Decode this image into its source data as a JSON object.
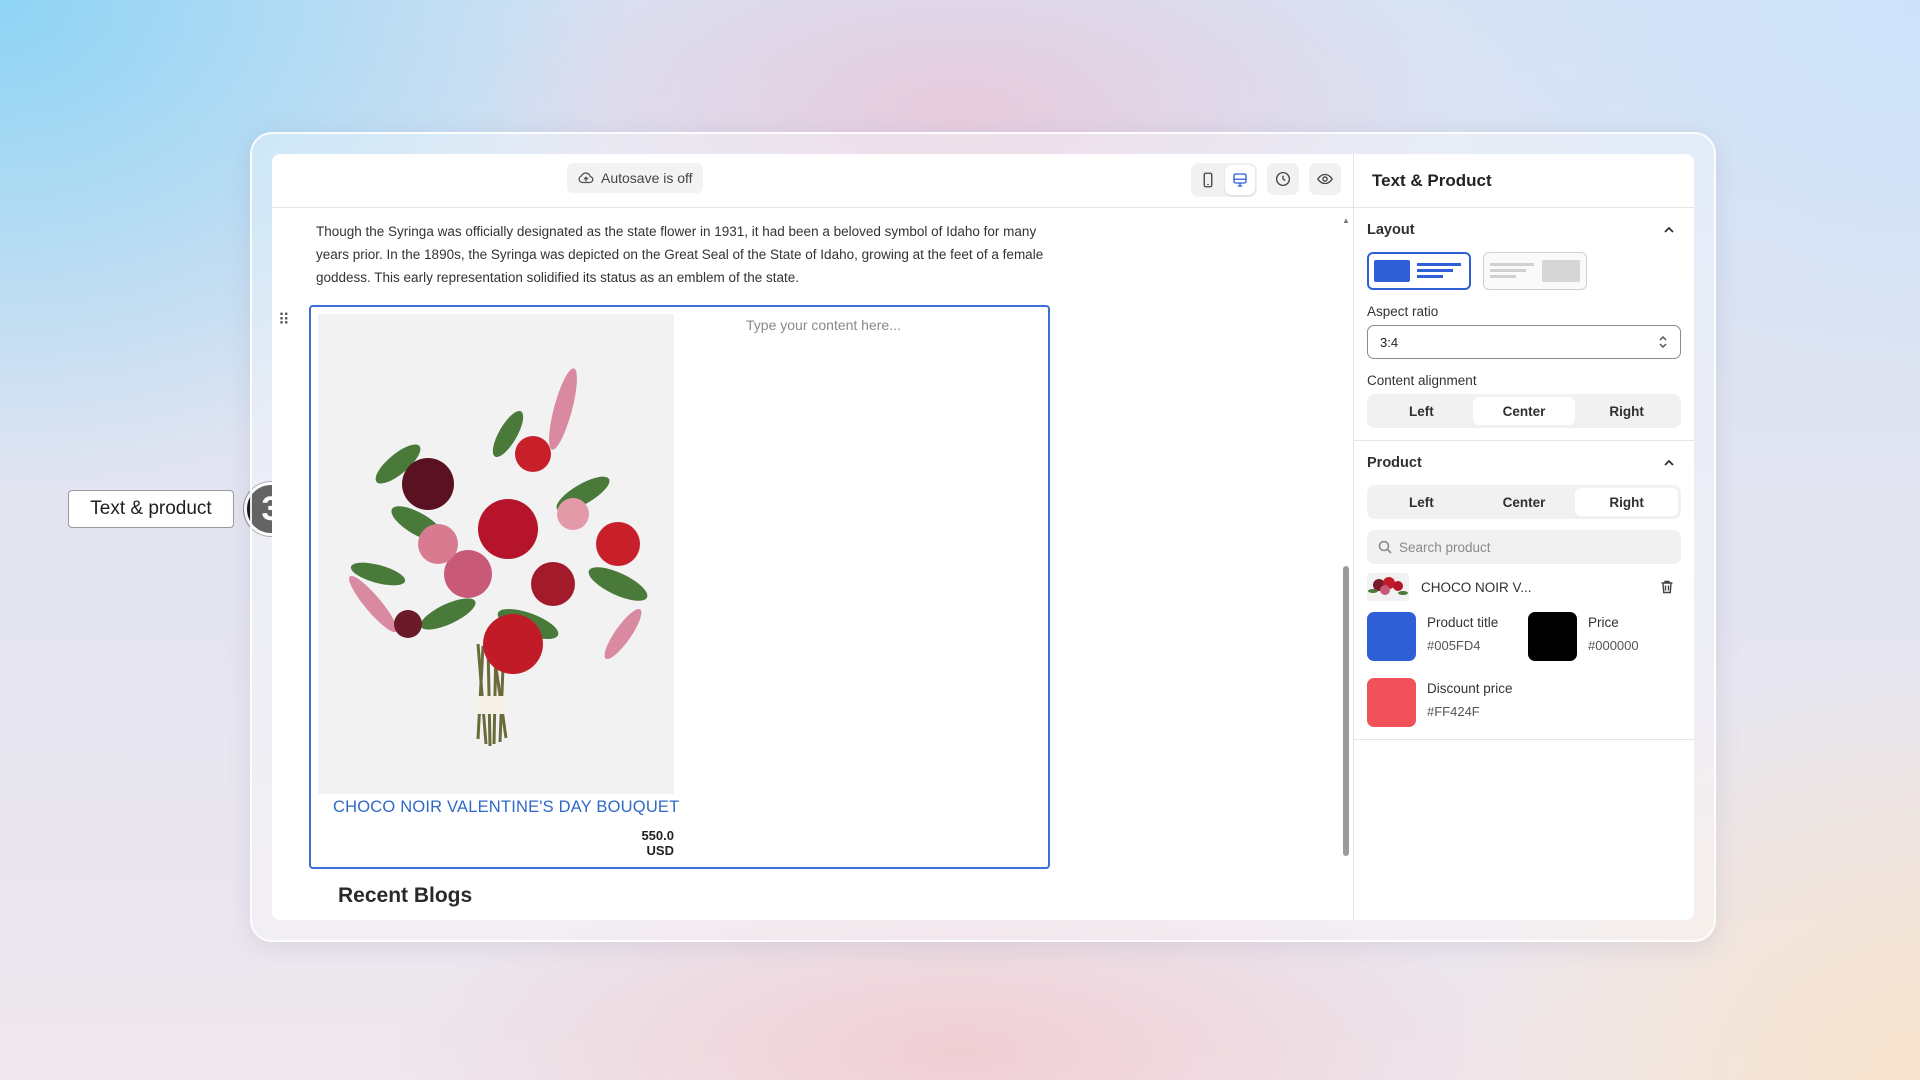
{
  "callout": {
    "label": "Text & product",
    "step": "3"
  },
  "toolbar": {
    "autosave_label": "Autosave is off"
  },
  "editor": {
    "paragraph": "Though the Syringa was officially designated as the state flower in 1931, it had been a beloved symbol of Idaho for many years prior. In the 1890s, the Syringa was depicted on the Great Seal of the State of Idaho, growing at the feet of a female goddess. This early representation solidified its status as an emblem of the state.",
    "content_placeholder": "Type your content here...",
    "product_title": "CHOCO NOIR VALENTINE'S DAY BOUQUET",
    "product_price": "550.0 USD",
    "recent_blogs": "Recent Blogs"
  },
  "panel": {
    "title": "Text & Product",
    "layout_section": "Layout",
    "aspect_ratio_label": "Aspect ratio",
    "aspect_ratio_value": "3:4",
    "content_alignment_label": "Content alignment",
    "content_alignment": {
      "options": [
        "Left",
        "Center",
        "Right"
      ],
      "selected": "Center"
    },
    "product_section": "Product",
    "product_alignment": {
      "options": [
        "Left",
        "Center",
        "Right"
      ],
      "selected": "Right"
    },
    "search_placeholder": "Search product",
    "selected_product": "CHOCO NOIR V...",
    "colors": [
      {
        "name": "Product title",
        "hex": "#005FD4",
        "swatch": "#2f5fd6"
      },
      {
        "name": "Price",
        "hex": "#000000",
        "swatch": "#000000"
      },
      {
        "name": "Discount price",
        "hex": "#FF424F",
        "swatch": "#f0515b"
      }
    ]
  }
}
